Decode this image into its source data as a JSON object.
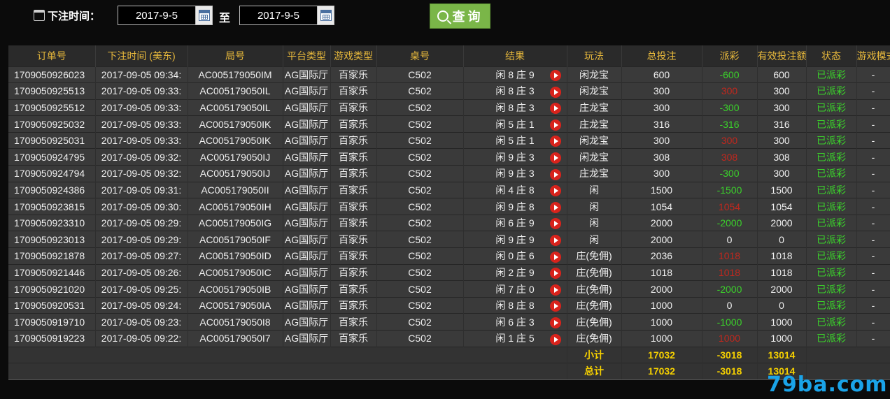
{
  "filter": {
    "label": "下注时间：",
    "start_date": "2017-9-5",
    "to_label": "至",
    "end_date": "2017-9-5",
    "query_label": "查询"
  },
  "table": {
    "headers": [
      "订单号",
      "下注时间 (美东)",
      "局号",
      "平台类型",
      "游戏类型",
      "桌号",
      "结果",
      "玩法",
      "总投注",
      "派彩",
      "有效投注额",
      "状态",
      "游戏模式"
    ],
    "rows": [
      {
        "order": "1709050926023",
        "time": "2017-09-05 09:34:",
        "round": "AC005179050IM",
        "platform": "AG国际厅",
        "game": "百家乐",
        "table": "C502",
        "result": "闲 8 庄 9",
        "play": "闲龙宝",
        "bet": "600",
        "payout": "-600",
        "payout_color": "green",
        "valid": "600",
        "status": "已派彩",
        "mode": "-"
      },
      {
        "order": "1709050925513",
        "time": "2017-09-05 09:33:",
        "round": "AC005179050IL",
        "platform": "AG国际厅",
        "game": "百家乐",
        "table": "C502",
        "result": "闲 8 庄 3",
        "play": "闲龙宝",
        "bet": "300",
        "payout": "300",
        "payout_color": "red",
        "valid": "300",
        "status": "已派彩",
        "mode": "-"
      },
      {
        "order": "1709050925512",
        "time": "2017-09-05 09:33:",
        "round": "AC005179050IL",
        "platform": "AG国际厅",
        "game": "百家乐",
        "table": "C502",
        "result": "闲 8 庄 3",
        "play": "庄龙宝",
        "bet": "300",
        "payout": "-300",
        "payout_color": "green",
        "valid": "300",
        "status": "已派彩",
        "mode": "-"
      },
      {
        "order": "1709050925032",
        "time": "2017-09-05 09:33:",
        "round": "AC005179050IK",
        "platform": "AG国际厅",
        "game": "百家乐",
        "table": "C502",
        "result": "闲 5 庄 1",
        "play": "庄龙宝",
        "bet": "316",
        "payout": "-316",
        "payout_color": "green",
        "valid": "316",
        "status": "已派彩",
        "mode": "-"
      },
      {
        "order": "1709050925031",
        "time": "2017-09-05 09:33:",
        "round": "AC005179050IK",
        "platform": "AG国际厅",
        "game": "百家乐",
        "table": "C502",
        "result": "闲 5 庄 1",
        "play": "闲龙宝",
        "bet": "300",
        "payout": "300",
        "payout_color": "red",
        "valid": "300",
        "status": "已派彩",
        "mode": "-"
      },
      {
        "order": "1709050924795",
        "time": "2017-09-05 09:32:",
        "round": "AC005179050IJ",
        "platform": "AG国际厅",
        "game": "百家乐",
        "table": "C502",
        "result": "闲 9 庄 3",
        "play": "闲龙宝",
        "bet": "308",
        "payout": "308",
        "payout_color": "red",
        "valid": "308",
        "status": "已派彩",
        "mode": "-"
      },
      {
        "order": "1709050924794",
        "time": "2017-09-05 09:32:",
        "round": "AC005179050IJ",
        "platform": "AG国际厅",
        "game": "百家乐",
        "table": "C502",
        "result": "闲 9 庄 3",
        "play": "庄龙宝",
        "bet": "300",
        "payout": "-300",
        "payout_color": "green",
        "valid": "300",
        "status": "已派彩",
        "mode": "-"
      },
      {
        "order": "1709050924386",
        "time": "2017-09-05 09:31:",
        "round": "AC005179050II",
        "platform": "AG国际厅",
        "game": "百家乐",
        "table": "C502",
        "result": "闲 4 庄 8",
        "play": "闲",
        "bet": "1500",
        "payout": "-1500",
        "payout_color": "green",
        "valid": "1500",
        "status": "已派彩",
        "mode": "-"
      },
      {
        "order": "1709050923815",
        "time": "2017-09-05 09:30:",
        "round": "AC005179050IH",
        "platform": "AG国际厅",
        "game": "百家乐",
        "table": "C502",
        "result": "闲 9 庄 8",
        "play": "闲",
        "bet": "1054",
        "payout": "1054",
        "payout_color": "red",
        "valid": "1054",
        "status": "已派彩",
        "mode": "-"
      },
      {
        "order": "1709050923310",
        "time": "2017-09-05 09:29:",
        "round": "AC005179050IG",
        "platform": "AG国际厅",
        "game": "百家乐",
        "table": "C502",
        "result": "闲 6 庄 9",
        "play": "闲",
        "bet": "2000",
        "payout": "-2000",
        "payout_color": "green",
        "valid": "2000",
        "status": "已派彩",
        "mode": "-"
      },
      {
        "order": "1709050923013",
        "time": "2017-09-05 09:29:",
        "round": "AC005179050IF",
        "platform": "AG国际厅",
        "game": "百家乐",
        "table": "C502",
        "result": "闲 9 庄 9",
        "play": "闲",
        "bet": "2000",
        "payout": "0",
        "payout_color": "white",
        "valid": "0",
        "status": "已派彩",
        "mode": "-"
      },
      {
        "order": "1709050921878",
        "time": "2017-09-05 09:27:",
        "round": "AC005179050ID",
        "platform": "AG国际厅",
        "game": "百家乐",
        "table": "C502",
        "result": "闲 0 庄 6",
        "play": "庄(免佣)",
        "bet": "2036",
        "payout": "1018",
        "payout_color": "red",
        "valid": "1018",
        "status": "已派彩",
        "mode": "-"
      },
      {
        "order": "1709050921446",
        "time": "2017-09-05 09:26:",
        "round": "AC005179050IC",
        "platform": "AG国际厅",
        "game": "百家乐",
        "table": "C502",
        "result": "闲 2 庄 9",
        "play": "庄(免佣)",
        "bet": "1018",
        "payout": "1018",
        "payout_color": "red",
        "valid": "1018",
        "status": "已派彩",
        "mode": "-"
      },
      {
        "order": "1709050921020",
        "time": "2017-09-05 09:25:",
        "round": "AC005179050IB",
        "platform": "AG国际厅",
        "game": "百家乐",
        "table": "C502",
        "result": "闲 7 庄 0",
        "play": "庄(免佣)",
        "bet": "2000",
        "payout": "-2000",
        "payout_color": "green",
        "valid": "2000",
        "status": "已派彩",
        "mode": "-"
      },
      {
        "order": "1709050920531",
        "time": "2017-09-05 09:24:",
        "round": "AC005179050IA",
        "platform": "AG国际厅",
        "game": "百家乐",
        "table": "C502",
        "result": "闲 8 庄 8",
        "play": "庄(免佣)",
        "bet": "1000",
        "payout": "0",
        "payout_color": "white",
        "valid": "0",
        "status": "已派彩",
        "mode": "-"
      },
      {
        "order": "1709050919710",
        "time": "2017-09-05 09:23:",
        "round": "AC005179050I8",
        "platform": "AG国际厅",
        "game": "百家乐",
        "table": "C502",
        "result": "闲 6 庄 3",
        "play": "庄(免佣)",
        "bet": "1000",
        "payout": "-1000",
        "payout_color": "green",
        "valid": "1000",
        "status": "已派彩",
        "mode": "-"
      },
      {
        "order": "1709050919223",
        "time": "2017-09-05 09:22:",
        "round": "AC005179050I7",
        "platform": "AG国际厅",
        "game": "百家乐",
        "table": "C502",
        "result": "闲 1 庄 5",
        "play": "庄(免佣)",
        "bet": "1000",
        "payout": "1000",
        "payout_color": "red",
        "valid": "1000",
        "status": "已派彩",
        "mode": "-"
      }
    ],
    "subtotal": {
      "label": "小计",
      "bet": "17032",
      "payout": "-3018",
      "valid": "13014"
    },
    "total": {
      "label": "总计",
      "bet": "17032",
      "payout": "-3018",
      "valid": "13014"
    }
  },
  "colors": {
    "gold": "#e8b93c",
    "green": "#3bd12b",
    "red": "#c0281e",
    "yellow": "#f5d000",
    "button": "#7ab648"
  },
  "icons": {
    "calendar": "calendar-icon",
    "search": "search-icon",
    "play": "play-video-icon"
  },
  "watermark": "79ba.com"
}
